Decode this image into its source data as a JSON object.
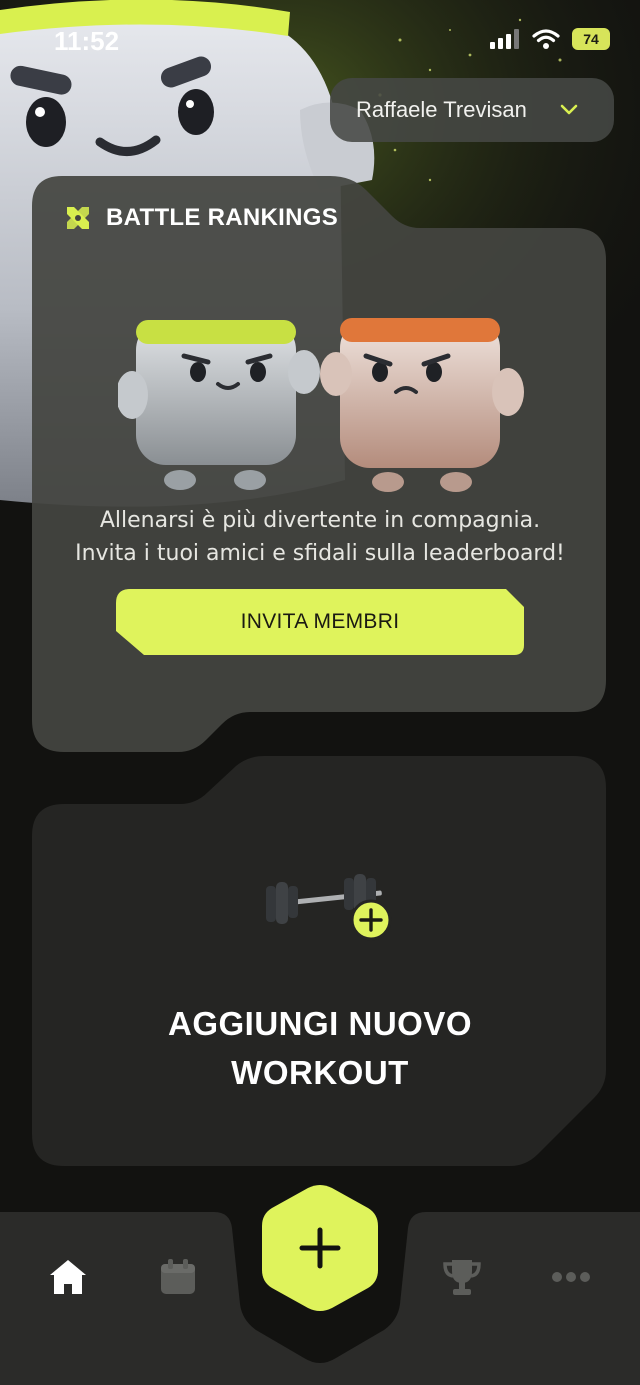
{
  "status_bar": {
    "time": "11:52",
    "battery": "74"
  },
  "user_select": {
    "name": "Raffaele Trevisan"
  },
  "battle_card": {
    "title": "BATTLE RANKINGS",
    "text_line1": "Allenarsi è più divertente in compagnia.",
    "text_line2": "Invita i tuoi amici e sfidali sulla leaderboard!",
    "button_label": "INVITA MEMBRI"
  },
  "workout_card": {
    "title_line1": "AGGIUNGI NUOVO",
    "title_line2": "WORKOUT"
  },
  "nav": {
    "items": [
      "home-icon",
      "calendar-icon",
      "plus-icon",
      "trophy-icon",
      "more-icon"
    ]
  },
  "colors": {
    "accent": "#dff35c",
    "card": "#444541",
    "card_dark": "#252523",
    "background": "#121210"
  }
}
